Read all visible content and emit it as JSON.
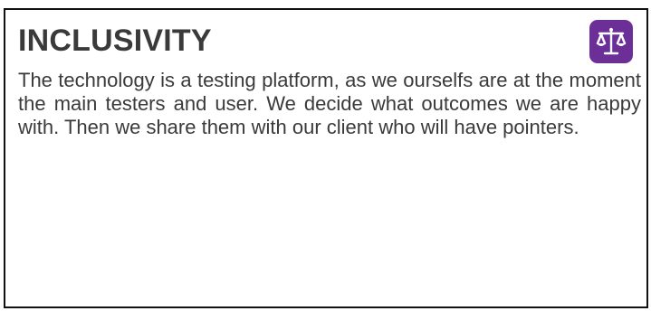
{
  "card": {
    "title": "INCLUSIVITY",
    "icon": "balance-scale-icon",
    "body": "The technology is a testing platform, as we ourselfs are at the moment the main testers and user. We decide what outcomes we are happy with. Then we share them with our client who will have pointers."
  },
  "colors": {
    "icon_background": "#6b2f97",
    "icon_foreground": "#ffffff",
    "text": "#3a3a3a",
    "border": "#111111"
  }
}
